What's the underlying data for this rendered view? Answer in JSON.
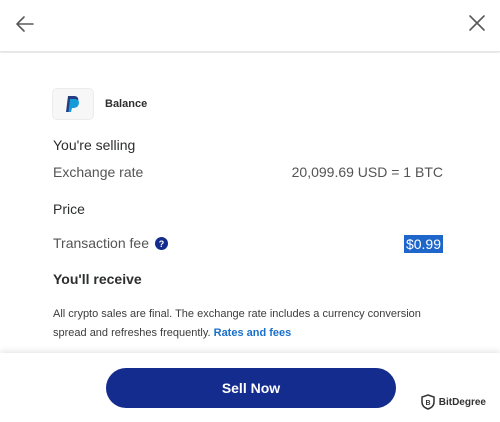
{
  "header": {
    "back_icon": "arrow-left-icon",
    "close_icon": "close-icon"
  },
  "source": {
    "logo": "paypal-logo-icon",
    "label": "Balance"
  },
  "details": {
    "selling_label": "You're selling",
    "exchange_label": "Exchange rate",
    "exchange_value": "20,099.69 USD = 1 BTC",
    "price_label": "Price",
    "fee_label": "Transaction fee",
    "fee_value": "$0.99",
    "receive_label": "You'll receive"
  },
  "disclaimer": {
    "text": "All crypto sales are final. The exchange rate includes a currency conversion spread and refreshes frequently.",
    "link_label": "Rates and fees"
  },
  "footer": {
    "sell_label": "Sell Now"
  },
  "watermark": {
    "text": "BitDegree",
    "icon": "bitdegree-shield-icon"
  },
  "colors": {
    "button": "#142c8e",
    "link": "#1a6fc9",
    "highlight": "#1e66c9"
  }
}
